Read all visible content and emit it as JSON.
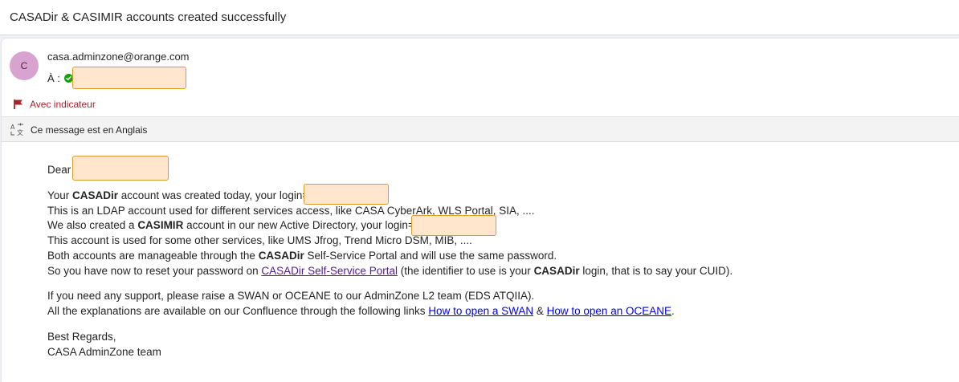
{
  "subject": "CASADir & CASIMIR accounts created successfully",
  "sender": {
    "avatar_initial": "C",
    "email": "casa.adminzone@orange.com",
    "to_label": "À :"
  },
  "flag": {
    "label": "Avec indicateur"
  },
  "translation": {
    "label": "Ce message est en Anglais"
  },
  "body": {
    "greeting": "Dear",
    "line1_pre": "Your ",
    "line1_bold": "CASADir",
    "line1_post": " account was created today, your login=",
    "line2": "This is an LDAP account used for different services access, like CASA CyberArk, WLS Portal, SIA, ....",
    "line3_pre": "We also created a ",
    "line3_bold": "CASIMIR",
    "line3_post": " account in our new Active Directory, your login=",
    "line4": "This account is used for some other services, like UMS Jfrog, Trend Micro DSM, MIB, ....",
    "line5_pre": "Both accounts are manageable through the ",
    "line5_bold": "CASADir",
    "line5_post": " Self-Service Portal and will use the same password.",
    "line6_pre": "So you have now to reset your password on ",
    "line6_link": "CASADir Self-Service Portal",
    "line6_mid": " (the identifier to use is your ",
    "line6_bold": "CASADir",
    "line6_post": " login, that is to say your CUID).",
    "support1": "If you need any support, please raise a SWAN or OCEANE to our AdminZone L2 team (EDS ATQIIA).",
    "support2_pre": "All the explanations are available on our Confluence through the following links ",
    "support2_link1": "How to open a SWAN",
    "support2_amp": " & ",
    "support2_link2": "How to open an OCEANE",
    "support2_post": ".",
    "regards": "Best Regards,",
    "team": "CASA AdminZone team"
  },
  "colors": {
    "flag_red": "#a4262c",
    "avatar_bg": "#d9a3cf",
    "check_green": "#13a10e",
    "redaction_fill": "#ffe6cc",
    "redaction_border": "#d99c2b",
    "link": "#0000ee",
    "visited_link": "#551a8b"
  },
  "icons": {
    "flag": "flag-icon",
    "translate": "translate-icon",
    "check": "check-icon"
  }
}
